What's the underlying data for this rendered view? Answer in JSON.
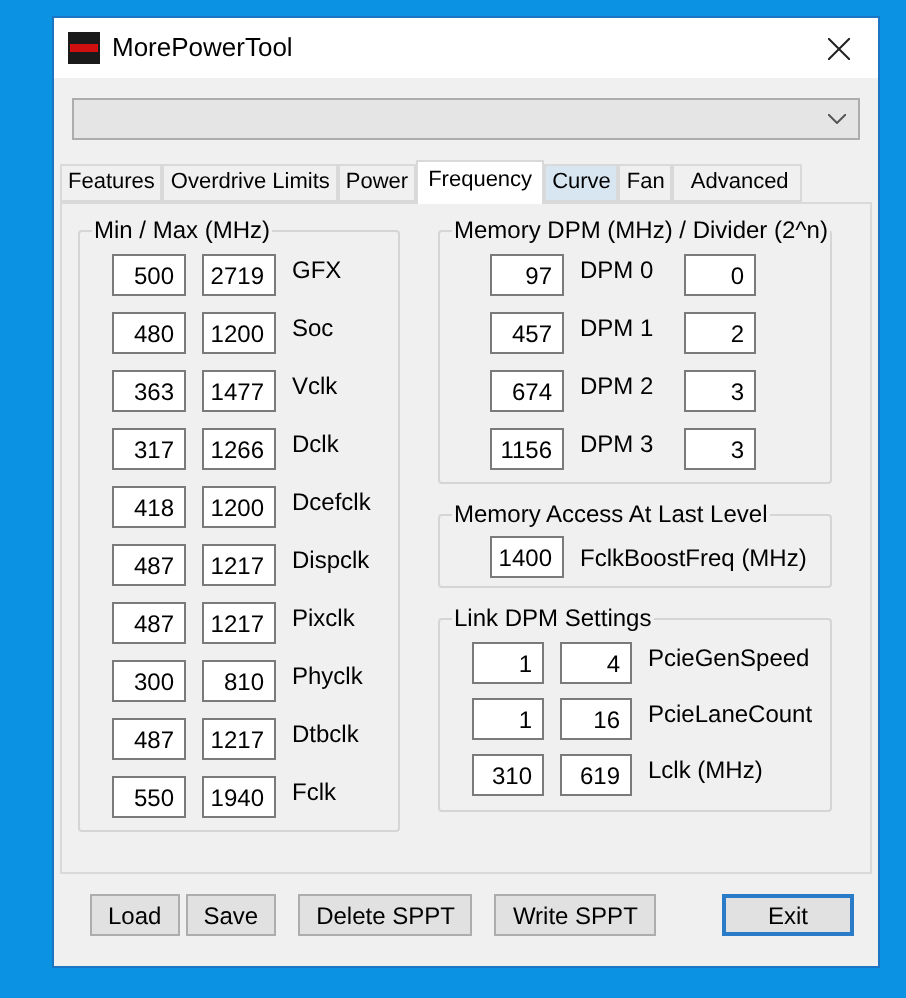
{
  "window": {
    "title": "MorePowerTool"
  },
  "tabs": [
    {
      "label": "Features",
      "selected": false,
      "hovered": false
    },
    {
      "label": "Overdrive Limits",
      "selected": false,
      "hovered": false
    },
    {
      "label": "Power",
      "selected": false,
      "hovered": false
    },
    {
      "label": "Frequency",
      "selected": true,
      "hovered": false
    },
    {
      "label": "Curve",
      "selected": false,
      "hovered": true
    },
    {
      "label": "Fan",
      "selected": false,
      "hovered": false
    },
    {
      "label": "Advanced",
      "selected": false,
      "hovered": false
    }
  ],
  "min_max": {
    "title": "Min / Max (MHz)",
    "rows": [
      {
        "min": "500",
        "max": "2719",
        "label": "GFX"
      },
      {
        "min": "480",
        "max": "1200",
        "label": "Soc"
      },
      {
        "min": "363",
        "max": "1477",
        "label": "Vclk"
      },
      {
        "min": "317",
        "max": "1266",
        "label": "Dclk"
      },
      {
        "min": "418",
        "max": "1200",
        "label": "Dcefclk"
      },
      {
        "min": "487",
        "max": "1217",
        "label": "Dispclk"
      },
      {
        "min": "487",
        "max": "1217",
        "label": "Pixclk"
      },
      {
        "min": "300",
        "max": "810",
        "label": "Phyclk"
      },
      {
        "min": "487",
        "max": "1217",
        "label": "Dtbclk"
      },
      {
        "min": "550",
        "max": "1940",
        "label": "Fclk"
      }
    ]
  },
  "memory_dpm": {
    "title": "Memory DPM (MHz) / Divider (2^n)",
    "rows": [
      {
        "frequency": "97",
        "label": "DPM 0",
        "divider": "0"
      },
      {
        "frequency": "457",
        "label": "DPM 1",
        "divider": "2"
      },
      {
        "frequency": "674",
        "label": "DPM 2",
        "divider": "3"
      },
      {
        "frequency": "1156",
        "label": "DPM 3",
        "divider": "3"
      }
    ]
  },
  "memory_access": {
    "title": "Memory Access At Last Level",
    "value": "1400",
    "label": "FclkBoostFreq (MHz)"
  },
  "link_dpm": {
    "title": "Link DPM Settings",
    "rows": [
      {
        "min": "1",
        "max": "4",
        "label": "PcieGenSpeed"
      },
      {
        "min": "1",
        "max": "16",
        "label": "PcieLaneCount"
      },
      {
        "min": "310",
        "max": "619",
        "label": "Lclk (MHz)"
      }
    ]
  },
  "buttons": [
    {
      "label": "Load",
      "default": false
    },
    {
      "label": "Save",
      "default": false
    },
    {
      "label": "Delete SPPT",
      "default": false
    },
    {
      "label": "Write SPPT",
      "default": false
    },
    {
      "label": "Exit",
      "default": true
    }
  ]
}
